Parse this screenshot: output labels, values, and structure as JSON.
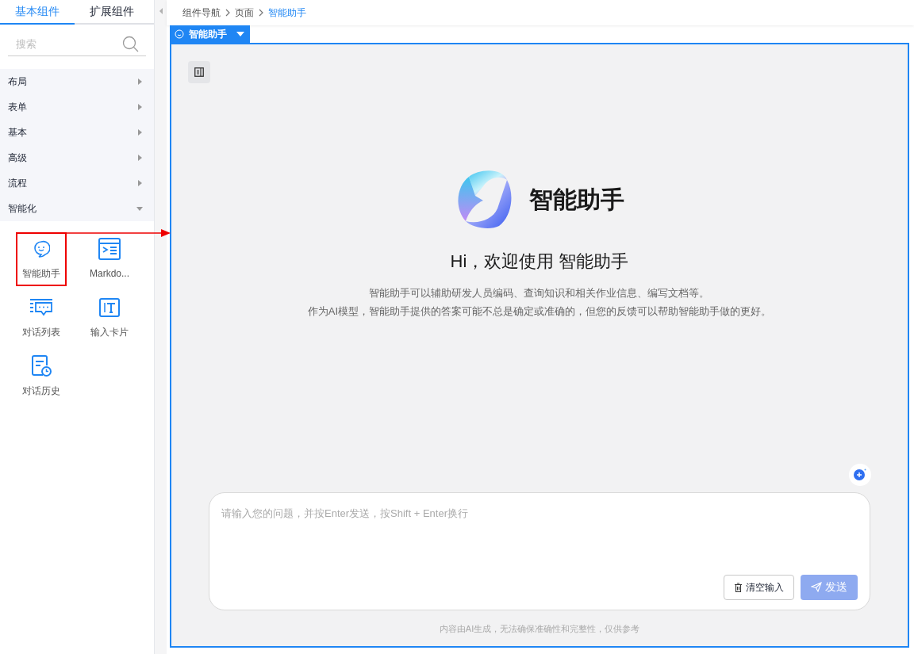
{
  "sidebar": {
    "tabs": [
      {
        "label": "基本组件",
        "selected": true
      },
      {
        "label": "扩展组件",
        "selected": false
      }
    ],
    "search": {
      "placeholder": "搜索"
    },
    "categories": [
      {
        "label": "布局",
        "expanded": false
      },
      {
        "label": "表单",
        "expanded": false
      },
      {
        "label": "基本",
        "expanded": false
      },
      {
        "label": "高级",
        "expanded": false
      },
      {
        "label": "流程",
        "expanded": false
      },
      {
        "label": "智能化",
        "expanded": true
      }
    ],
    "components": [
      {
        "label": "智能助手",
        "selected": true
      },
      {
        "label": "Markdo...",
        "selected": false
      },
      {
        "label": "对话列表",
        "selected": false
      },
      {
        "label": "输入卡片",
        "selected": false
      },
      {
        "label": "对话历史",
        "selected": false
      }
    ]
  },
  "breadcrumb": [
    "组件导航",
    "页面",
    "智能助手"
  ],
  "selected_tag": {
    "label": "智能助手"
  },
  "assistant": {
    "title": "智能助手",
    "greeting": "Hi，欢迎使用 智能助手",
    "description": [
      "智能助手可以辅助研发人员编码、查询知识和相关作业信息、编写文档等。",
      "作为AI模型，智能助手提供的答案可能不总是确定或准确的，但您的反馈可以帮助智能助手做的更好。"
    ],
    "input": {
      "placeholder": "请输入您的问题，并按Enter发送，按Shift + Enter换行"
    },
    "buttons": [
      {
        "label": "清空输入",
        "kind": "clear",
        "disabled": false
      },
      {
        "label": "发送",
        "kind": "send",
        "disabled": true
      }
    ],
    "footer": "内容由AI生成，无法确保准确性和完整性，仅供参考"
  }
}
